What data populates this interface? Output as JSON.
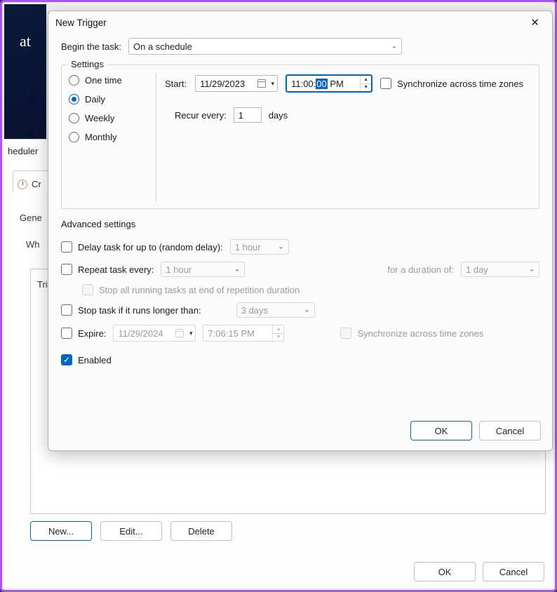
{
  "window": {
    "title": "New Trigger"
  },
  "begin_task": {
    "label": "Begin the task:",
    "value": "On a schedule"
  },
  "settings": {
    "legend": "Settings",
    "frequency": {
      "one_time": "One time",
      "daily": "Daily",
      "weekly": "Weekly",
      "monthly": "Monthly",
      "selected": "daily"
    },
    "start_label": "Start:",
    "start_date": "11/29/2023",
    "start_time": {
      "hh": "11",
      "mm": "00",
      "ss": "00",
      "ampm": "PM",
      "selected_segment": "ss"
    },
    "sync_tz_label": "Synchronize across time zones",
    "recur_label": "Recur every:",
    "recur_value": "1",
    "recur_unit": "days"
  },
  "advanced": {
    "legend": "Advanced settings",
    "delay_label": "Delay task for up to (random delay):",
    "delay_value": "1 hour",
    "repeat_label": "Repeat task every:",
    "repeat_value": "1 hour",
    "repeat_duration_label": "for a duration of:",
    "repeat_duration_value": "1 day",
    "stop_all_label": "Stop all running tasks at end of repetition duration",
    "stop_if_longer_label": "Stop task if it runs longer than:",
    "stop_if_longer_value": "3 days",
    "expire_label": "Expire:",
    "expire_date": "11/29/2024",
    "expire_time": "7:06:15 PM",
    "sync_tz2_label": "Synchronize across time zones",
    "enabled_label": "Enabled"
  },
  "buttons": {
    "ok": "OK",
    "cancel": "Cancel",
    "new": "New...",
    "edit": "Edit...",
    "delete": "Delete"
  },
  "background": {
    "sched": "heduler",
    "cr": "Cr",
    "gene": "Gene",
    "wh": "Wh",
    "tri": "Tri",
    "at": "at"
  }
}
